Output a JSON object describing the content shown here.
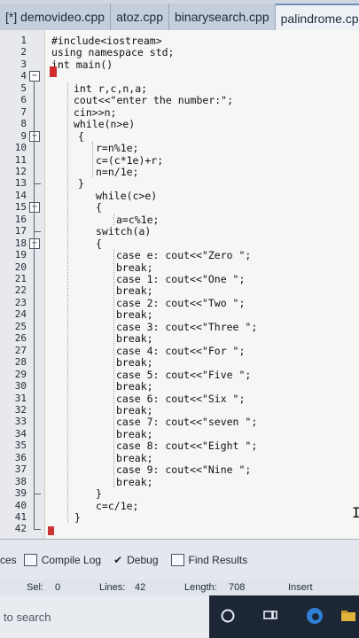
{
  "tabs": [
    "[*] demovideo.cpp",
    "atoz.cpp",
    "binarysearch.cpp",
    "palindrome.cp"
  ],
  "line_numbers": [
    "1",
    "2",
    "3",
    "4",
    "5",
    "6",
    "7",
    "8",
    "9",
    "10",
    "11",
    "12",
    "13",
    "14",
    "15",
    "16",
    "17",
    "18",
    "19",
    "20",
    "21",
    "22",
    "23",
    "24",
    "25",
    "26",
    "27",
    "28",
    "29",
    "30",
    "31",
    "32",
    "33",
    "34",
    "35",
    "36",
    "37",
    "38",
    "39",
    "40",
    "41",
    "42"
  ],
  "code_lines": [
    "#include<iostream>",
    "using namespace std;",
    "int main()",
    "",
    "int r,c,n,a;",
    "cout<<\"enter the number:\";",
    "cin>>n;",
    "while(n>e)",
    "{",
    "r=n%1e;",
    "c=(c*1e)+r;",
    "n=n/1e;",
    "}",
    "while(c>e)",
    "{",
    "a=c%1e;",
    "switch(a)",
    "{",
    "case e: cout<<\"Zero \";",
    "break;",
    "case 1: cout<<\"One \";",
    "break;",
    "case 2: cout<<\"Two \";",
    "break;",
    "case 3: cout<<\"Three \";",
    "break;",
    "case 4: cout<<\"For \";",
    "break;",
    "case 5: cout<<\"Five \";",
    "break;",
    "case 6: cout<<\"Six \";",
    "break;",
    "case 7: cout<<\"seven \";",
    "break;",
    "case 8: cout<<\"Eight \";",
    "break;",
    "case 9: cout<<\"Nine \";",
    "break;",
    "}",
    "c=c/1e;",
    "}",
    ""
  ],
  "bottom_panel": {
    "partial_left": "ces",
    "compile_log": "Compile Log",
    "debug": "Debug",
    "find_results": "Find Results"
  },
  "status": {
    "sel_label": "Sel:",
    "sel_value": "0",
    "lines_label": "Lines:",
    "lines_value": "42",
    "length_label": "Length:",
    "length_value": "708",
    "mode": "Insert"
  },
  "taskbar": {
    "search_placeholder": "to search"
  }
}
